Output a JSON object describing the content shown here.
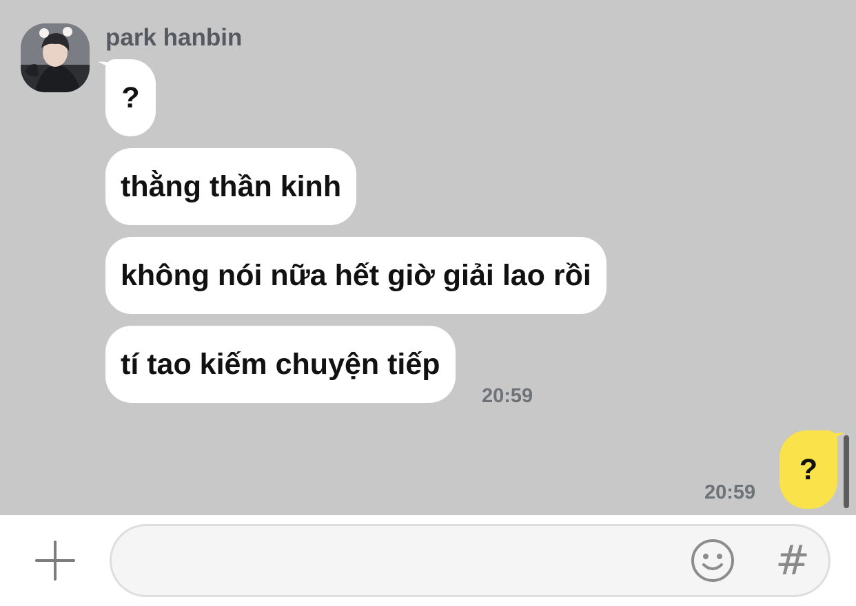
{
  "conversation": {
    "sender_name": "park hanbin",
    "received_messages": [
      {
        "text": "?"
      },
      {
        "text": "thằng thần kinh"
      },
      {
        "text": "không nói nữa hết giờ giải lao rồi"
      },
      {
        "text": "tí tao kiếm chuyện tiếp"
      }
    ],
    "received_time": "20:59",
    "sent_messages": [
      {
        "text": "?"
      }
    ],
    "sent_time": "20:59"
  },
  "input_bar": {
    "placeholder": "",
    "value": "",
    "add_icon": "plus-icon",
    "emoji_icon": "smiley-icon",
    "hashtag_label": "#"
  },
  "colors": {
    "chat_background": "#c8c8c8",
    "received_bubble": "#ffffff",
    "sent_bubble": "#f9e24a"
  }
}
